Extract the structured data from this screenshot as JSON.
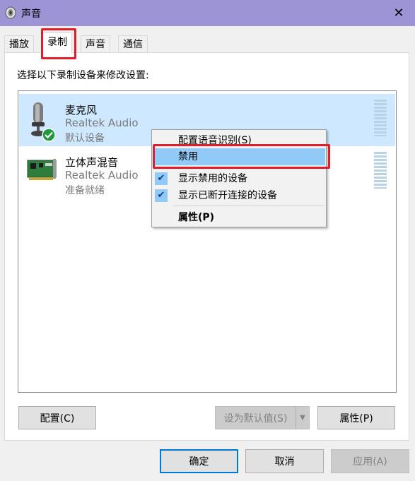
{
  "window": {
    "title": "声音",
    "close_glyph": "✕",
    "icon": "speaker-icon"
  },
  "tabs": [
    {
      "label": "播放",
      "active": false
    },
    {
      "label": "录制",
      "active": true
    },
    {
      "label": "声音",
      "active": false
    },
    {
      "label": "通信",
      "active": false
    }
  ],
  "instruction": "选择以下录制设备来修改设置:",
  "devices": [
    {
      "name": "麦克风",
      "driver": "Realtek Audio",
      "status": "默认设备",
      "icon": "microphone-icon",
      "selected": true,
      "badge": "default-check-icon"
    },
    {
      "name": "立体声混音",
      "driver": "Realtek Audio",
      "status": "准备就绪",
      "icon": "sound-card-icon",
      "selected": false
    }
  ],
  "context_menu": {
    "items": [
      {
        "label": "配置语音识别(S)",
        "checked": false,
        "highlighted": false,
        "bold": false
      },
      {
        "label": "禁用",
        "checked": false,
        "highlighted": true,
        "bold": false
      },
      {
        "label": "显示禁用的设备",
        "checked": true,
        "highlighted": false,
        "bold": false
      },
      {
        "label": "显示已断开连接的设备",
        "checked": true,
        "highlighted": false,
        "bold": false
      },
      {
        "label": "属性(P)",
        "checked": false,
        "highlighted": false,
        "bold": true
      }
    ],
    "check_glyph": "✔"
  },
  "panel_buttons": {
    "configure": "配置(C)",
    "set_default": "设为默认值(S)",
    "set_default_arrow": "▼",
    "properties": "属性(P)"
  },
  "dialog_buttons": {
    "ok": "确定",
    "cancel": "取消",
    "apply": "应用(A)"
  },
  "colors": {
    "titlebar": "#9d94d6",
    "selection": "#cde8ff",
    "menu_highlight": "#91c9f7",
    "annotation_red": "#e41c2a",
    "accent": "#0078d7"
  }
}
